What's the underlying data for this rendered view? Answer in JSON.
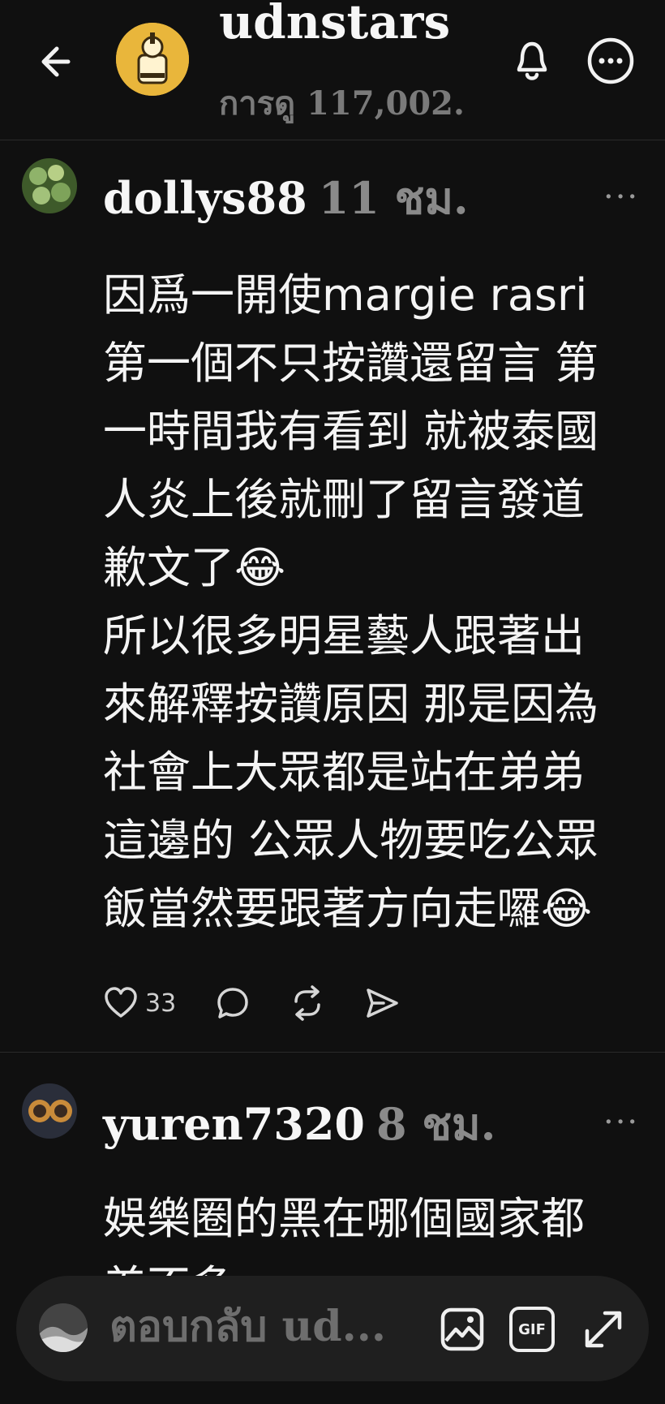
{
  "header": {
    "title": "udnstars",
    "views": "การดู 117,002.",
    "icons": [
      "back-arrow-icon",
      "bell-icon",
      "more-circle-icon"
    ]
  },
  "posts": [
    {
      "username": "dollys88",
      "time": "11 ชม.",
      "text": "因爲一開使margie rasri\n第一個不只按讚還留言 第\n一時間我有看到 就被泰國\n人炎上後就刪了留言發道\n歉文了😂\n所以很多明星藝人跟著出\n來解釋按讚原因 那是因為\n社會上大眾都是站在弟弟\n這邊的 公眾人物要吃公眾\n飯當然要跟著方向走囉😂",
      "likes": "33"
    },
    {
      "username": "yuren7320",
      "time": "8 ชม.",
      "text": "娛樂圈的黑在哪個國家都\n差不多"
    }
  ],
  "reply_bar": {
    "placeholder": "ตอบกลับ ud...",
    "gif_label": "GIF"
  },
  "colors": {
    "background": "#101010",
    "text": "#f3f3f3",
    "muted": "#8a8a8a",
    "reply_bar": "#1f1f1f"
  }
}
